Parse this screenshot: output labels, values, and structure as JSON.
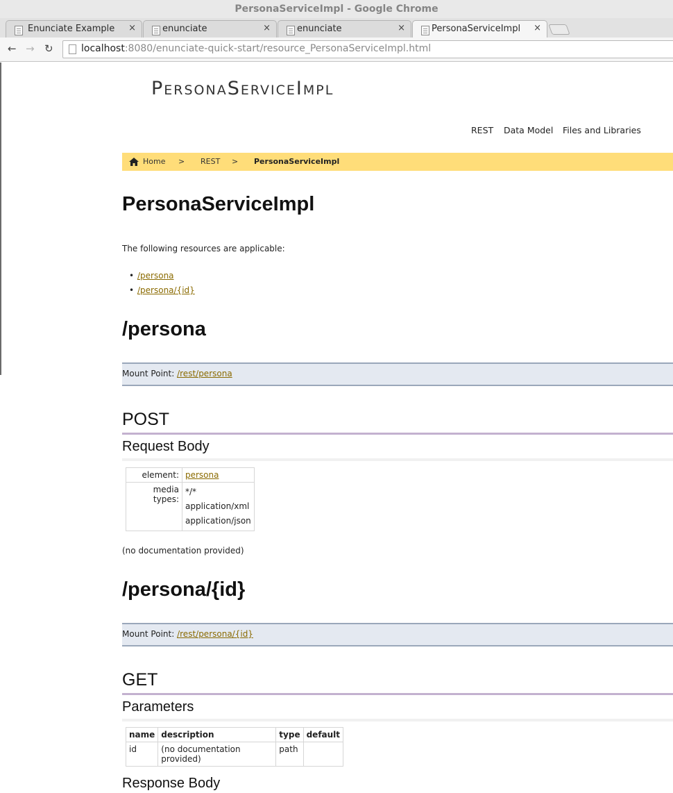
{
  "window": {
    "title": "PersonaServiceImpl - Google Chrome"
  },
  "tabs": [
    {
      "label": "Enunciate Example",
      "close": "×"
    },
    {
      "label": "enunciate",
      "close": "×"
    },
    {
      "label": "enunciate",
      "close": "×"
    },
    {
      "label": "PersonaServiceImpl",
      "close": "×"
    }
  ],
  "toolbar": {
    "back": "←",
    "forward": "→",
    "reload": "↻",
    "url_host": "localhost",
    "url_path": ":8080/enunciate-quick-start/resource_PersonaServiceImpl.html"
  },
  "page": {
    "site_title": "PersonaServiceImpl",
    "nav": [
      "REST",
      "Data Model",
      "Files and Libraries"
    ],
    "breadcrumb": {
      "home": "Home",
      "sep": ">",
      "rest": "REST",
      "current": "PersonaServiceImpl"
    },
    "heading": "PersonaServiceImpl",
    "intro": "The following resources are applicable:",
    "resource_links": [
      "/persona",
      "/persona/{id}"
    ],
    "resources": [
      {
        "title": "/persona",
        "mount_label": "Mount Point:",
        "mount_link": "/rest/persona",
        "method": "POST",
        "section": "Request Body",
        "element_label": "element:",
        "element_value": "persona",
        "media_label": "media types:",
        "media_types": [
          "*/*",
          "application/xml",
          "application/json"
        ],
        "doc": "(no documentation provided)"
      },
      {
        "title": "/persona/{id}",
        "mount_label": "Mount Point:",
        "mount_link": "/rest/persona/{id}",
        "method": "GET",
        "section": "Parameters",
        "params_header": [
          "name",
          "description",
          "type",
          "default"
        ],
        "params": [
          {
            "name": "id",
            "description": "(no documentation provided)",
            "type": "path",
            "default": ""
          }
        ],
        "next_section": "Response Body"
      }
    ]
  }
}
